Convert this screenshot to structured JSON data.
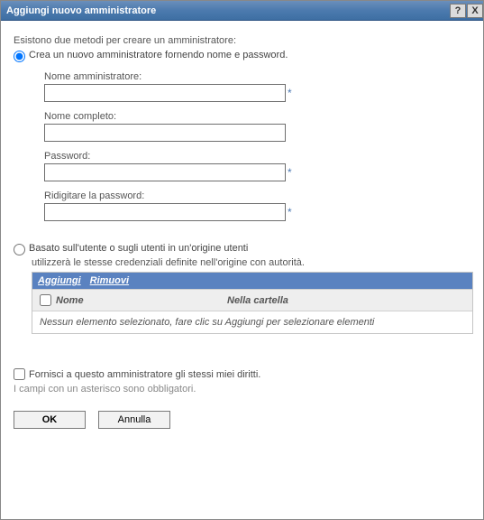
{
  "window": {
    "title": "Aggiungi nuovo amministratore",
    "help_icon": "?",
    "close_icon": "X"
  },
  "content": {
    "intro": "Esistono due metodi per creare un amministratore:",
    "option1": {
      "label": "Crea un nuovo amministratore fornendo nome e password.",
      "checked": true,
      "fields": {
        "admin_name": {
          "label": "Nome amministratore:",
          "value": "",
          "required": true
        },
        "full_name": {
          "label": "Nome completo:",
          "value": "",
          "required": false
        },
        "password": {
          "label": "Password:",
          "value": "",
          "required": true
        },
        "retype_pw": {
          "label": "Ridigitare la password:",
          "value": "",
          "required": true
        }
      }
    },
    "option2": {
      "label": "Basato sull'utente o sugli utenti in un'origine utenti",
      "checked": false,
      "subtext": "utilizzerà le stesse credenziali definite nell'origine con autorità.",
      "toolbar": {
        "add": "Aggiungi",
        "remove": "Rimuovi"
      },
      "columns": {
        "name": "Nome",
        "folder": "Nella cartella"
      },
      "empty": "Nessun elemento selezionato, fare clic su Aggiungi per selezionare elementi"
    },
    "same_rights": {
      "label": "Fornisci a questo amministratore gli stessi miei diritti.",
      "checked": false
    },
    "required_note": "I campi con un asterisco sono obbligatori.",
    "buttons": {
      "ok": "OK",
      "cancel": "Annulla"
    },
    "asterisk": "*"
  }
}
